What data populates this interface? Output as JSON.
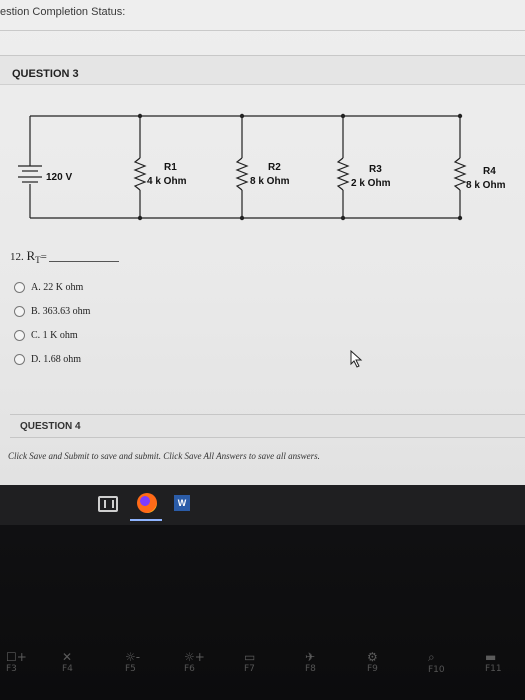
{
  "page": {
    "status_title": "estion Completion Status:"
  },
  "question3": {
    "header": "QUESTION 3",
    "circuit": {
      "source_label": "120 V",
      "resistors": [
        {
          "name": "R1",
          "value": "4 k Ohm"
        },
        {
          "name": "R2",
          "value": "8 k Ohm"
        },
        {
          "name": "R3",
          "value": "2 k Ohm"
        },
        {
          "name": "R4",
          "value": "8 k Ohm"
        }
      ]
    },
    "prompt_number": "12.",
    "prompt_var": "R",
    "prompt_sub": "T",
    "prompt_eq": "=",
    "options": [
      {
        "label": "A. 22 K ohm"
      },
      {
        "label": "B. 363.63 ohm"
      },
      {
        "label": "C. 1 K ohm"
      },
      {
        "label": "D. 1.68 ohm"
      }
    ]
  },
  "question4": {
    "header": "QUESTION 4"
  },
  "footer": {
    "save_note": "Click Save and Submit to save and submit. Click Save All Answers to save all answers."
  },
  "taskbar": {
    "icons": [
      "tablet-mode-icon",
      "firefox-icon",
      "word-icon"
    ],
    "word_letter": "W"
  },
  "keyboard": {
    "fkeys": [
      {
        "label": "F3",
        "symbol": "☐+"
      },
      {
        "label": "F4",
        "symbol": "✕"
      },
      {
        "label": "F5",
        "symbol": "☼-"
      },
      {
        "label": "F6",
        "symbol": "☼+"
      },
      {
        "label": "F7",
        "symbol": "▭"
      },
      {
        "label": "F8",
        "symbol": "✈"
      },
      {
        "label": "F9",
        "symbol": "⚙"
      },
      {
        "label": "F10",
        "symbol": "⌕"
      },
      {
        "label": "F11",
        "symbol": "▬"
      }
    ]
  }
}
